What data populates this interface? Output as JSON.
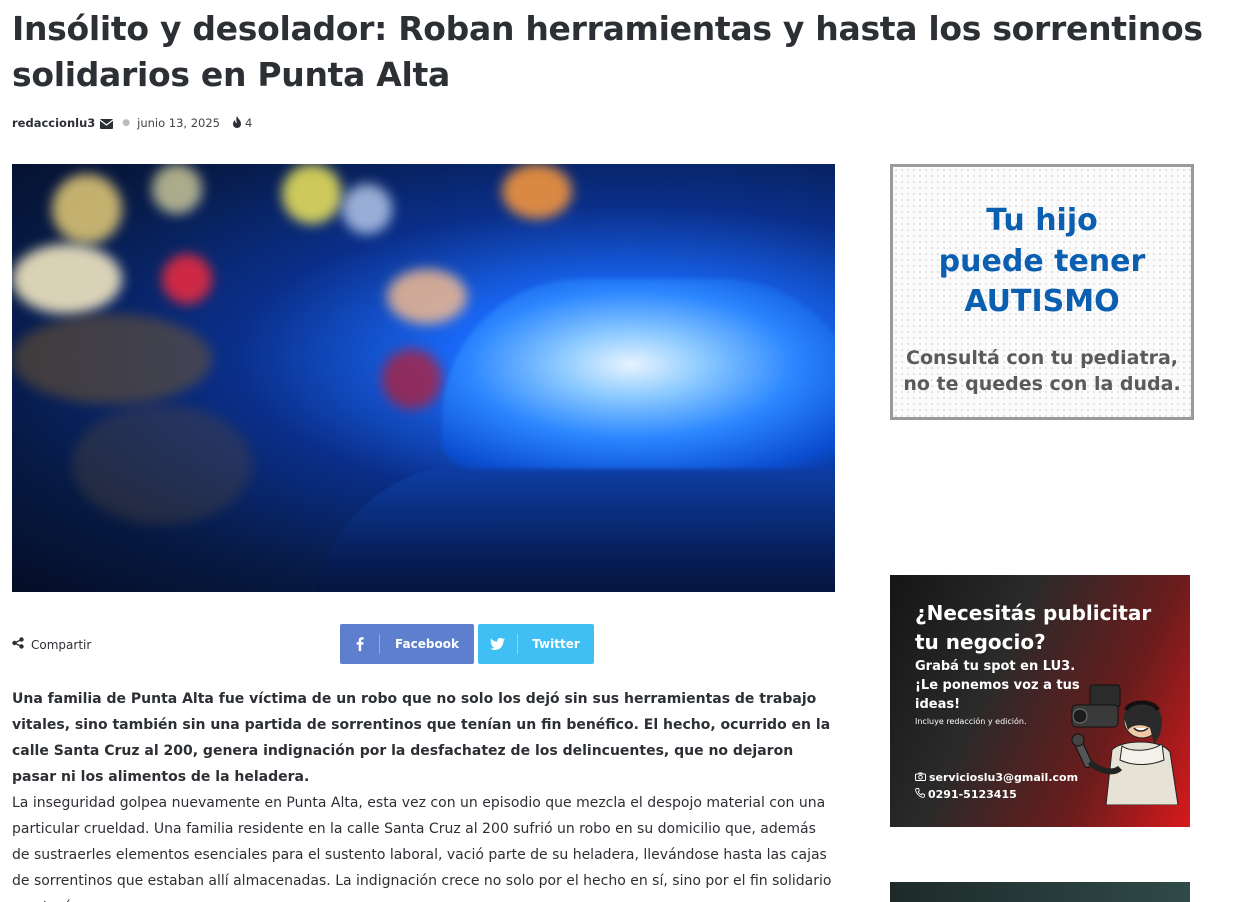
{
  "article": {
    "title": "Insólito y desolador: Roban herramientas y hasta los sorrentinos solidarios en Punta Alta",
    "author": "redaccionlu3",
    "date": "junio 13, 2025",
    "views": "4",
    "share_label": "Compartir",
    "share_buttons": {
      "facebook": "Facebook",
      "twitter": "Twitter"
    },
    "lead": "Una familia de Punta Alta fue víctima de un robo que no solo los dejó sin sus herramientas de trabajo vitales, sino también sin una partida de sorrentinos que tenían un fin benéfico. El hecho, ocurrido en la calle Santa Cruz al 200, genera indignación por la desfachatez de los delincuentes, que no dejaron pasar ni los alimentos de la heladera.",
    "body": "La inseguridad golpea nuevamente en Punta Alta, esta vez con un episodio que mezcla el despojo material con una particular crueldad. Una familia residente en la calle Santa Cruz al 200 sufrió un robo en su domicilio que, además de sustraerles elementos esenciales para el sustento laboral, vació parte de su heladera, llevándose hasta las cajas de sorrentinos que estaban allí almacenadas. La indignación crece no solo por el hecho en sí, sino por el fin solidario que tenían"
  },
  "sidebar": {
    "ad_autism": {
      "line1": "Tu hijo",
      "line2": "puede tener",
      "line3": "AUTISMO",
      "line4": "Consultá con tu pediatra,",
      "line5": "no te quedes con la duda."
    },
    "ad_publicity": {
      "headline": "¿Necesitás publicitar tu negocio?",
      "text": "Grabá tu spot en LU3. ¡Le ponemos voz a tus ideas!",
      "note": "Incluye redacción y edición.",
      "email": "servicioslu3@gmail.com",
      "phone": "0291-5123415"
    }
  },
  "icons": [
    "envelope-icon",
    "fire-icon",
    "share-icon",
    "facebook-icon",
    "twitter-icon",
    "camera-icon",
    "phone-icon"
  ],
  "colors": {
    "facebook": "#5d7fce",
    "twitter": "#40bff5",
    "title": "#2c2f34",
    "ad_blue": "#0b5fb0",
    "ad_red": "#d8191c"
  }
}
